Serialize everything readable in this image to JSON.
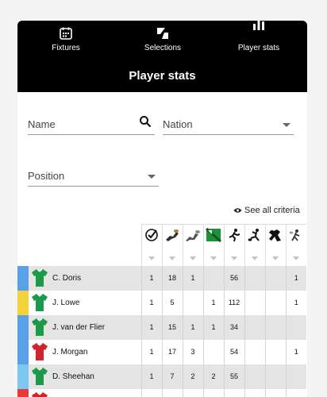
{
  "nav": {
    "tabs": [
      {
        "label": "Fixtures",
        "icon": "calendar-icon"
      },
      {
        "label": "Selections",
        "icon": "selections-icon"
      },
      {
        "label": "Player stats",
        "icon": "bar-chart-icon"
      }
    ],
    "active": "Player stats"
  },
  "page": {
    "title": "Player stats"
  },
  "filters": {
    "name_placeholder": "Name",
    "nation_placeholder": "Nation",
    "position_placeholder": "Position"
  },
  "see_all_label": "See all criteria",
  "stat_columns": [
    {
      "icon": "check-circle-icon"
    },
    {
      "icon": "tackle-icon"
    },
    {
      "icon": "try-icon"
    },
    {
      "icon": "pitch-icon"
    },
    {
      "icon": "runner-icon"
    },
    {
      "icon": "kick-icon"
    },
    {
      "icon": "lineout-icon"
    },
    {
      "icon": "pass-icon"
    }
  ],
  "players": [
    {
      "name": "C. Doris",
      "stripe": "#5aa0e6",
      "shirt": "#1a9a4a",
      "stats": [
        "1",
        "18",
        "1",
        "",
        "56",
        "",
        "",
        "1"
      ]
    },
    {
      "name": "J. Lowe",
      "stripe": "#f3d23a",
      "shirt": "#1a9a4a",
      "stats": [
        "1",
        "5",
        "",
        "1",
        "112",
        "",
        "",
        "1"
      ]
    },
    {
      "name": "J. van der Flier",
      "stripe": "#5aa0e6",
      "shirt": "#1a9a4a",
      "stats": [
        "1",
        "15",
        "1",
        "1",
        "34",
        "",
        "",
        ""
      ]
    },
    {
      "name": "J. Morgan",
      "stripe": "#5aa0e6",
      "shirt": "#d3212d",
      "stats": [
        "1",
        "17",
        "3",
        "",
        "54",
        "",
        "",
        "1"
      ]
    },
    {
      "name": "D. Sheehan",
      "stripe": "#7cc6ef",
      "shirt": "#1a9a4a",
      "stats": [
        "1",
        "7",
        "2",
        "2",
        "55",
        "",
        "",
        ""
      ]
    },
    {
      "name": "",
      "stripe": "#e83a3a",
      "shirt": "#d3212d",
      "stats": [
        "",
        "",
        "",
        "",
        "",
        "",
        "",
        ""
      ]
    }
  ]
}
